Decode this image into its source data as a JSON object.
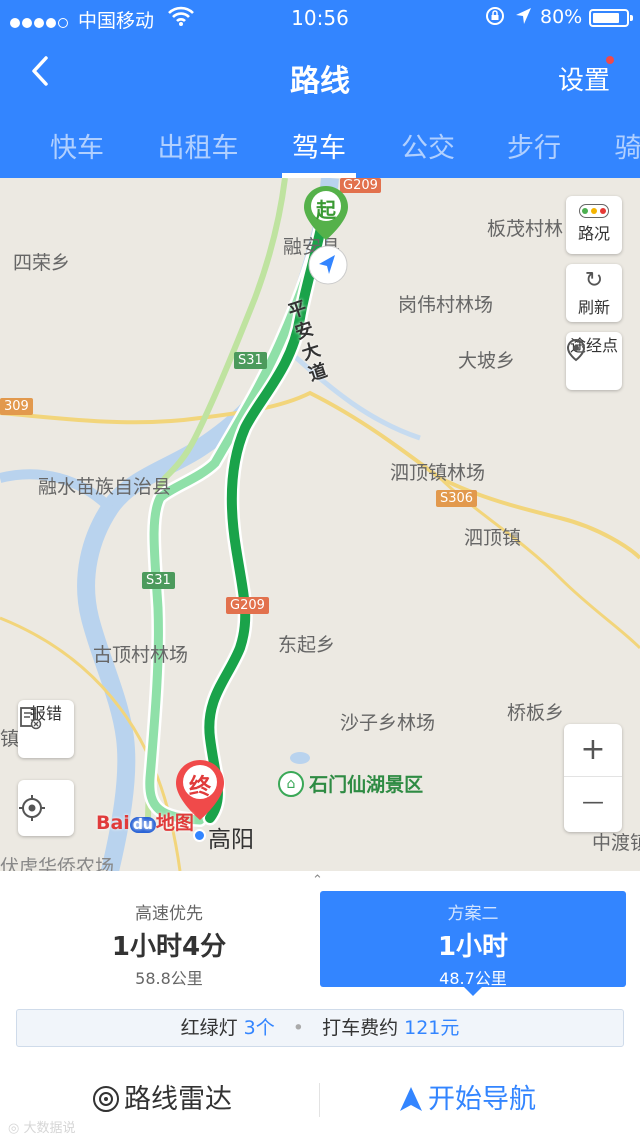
{
  "status_bar": {
    "carrier": "中国移动",
    "time": "10:56",
    "battery": "80%"
  },
  "header": {
    "title": "路线",
    "settings_label": "设置"
  },
  "tabs": [
    "快车",
    "出租车",
    "驾车",
    "公交",
    "步行",
    "骑"
  ],
  "active_tab": "驾车",
  "map": {
    "labels": {
      "rongan": "融安县",
      "bancun": "板茂村林",
      "sirong": "四荣乡",
      "gangwei": "岗伟村林场",
      "dapo": "大坡乡",
      "rongshui": "融水苗族自治县",
      "siding_forest": "泗顶镇林场",
      "siding": "泗顶镇",
      "dongqi": "东起乡",
      "guding": "古顶村林场",
      "shazi": "沙子乡林场",
      "qiaoban": "桥板乡",
      "shimen": "石门仙湖景区",
      "gaoyang": "高阳",
      "fuhu": "伏虎华侨农场",
      "zhongdu": "中渡镇",
      "zhen_left": "镇",
      "road_name": "平安大道"
    },
    "road_badges": {
      "g209_top": "G209",
      "s31_top": "S31",
      "s309": "309",
      "s306": "S306",
      "s31_mid": "S31",
      "g209_mid": "G209"
    },
    "markers": {
      "start": "起",
      "end": "终"
    },
    "buttons": {
      "traffic": "路况",
      "refresh": "刷新",
      "waypoint": "途经点",
      "report": "报错",
      "zoom_in": "+",
      "zoom_out": "—"
    },
    "logo": {
      "bai": "Bai",
      "du": "du",
      "ditu": "地图"
    }
  },
  "plans": [
    {
      "name": "高速优先",
      "time": "1小时4分",
      "distance": "58.8公里",
      "selected": false
    },
    {
      "name": "方案二",
      "time": "1小时",
      "distance": "48.7公里",
      "selected": true
    }
  ],
  "route_info": {
    "traffic_lights_label": "红绿灯",
    "traffic_lights_count": "3个",
    "separator": "•",
    "taxi_fare_label": "打车费约",
    "taxi_fare_value": "121元"
  },
  "actions": {
    "radar": "路线雷达",
    "start_nav": "开始导航"
  },
  "watermark": "大数据说",
  "colors": {
    "brand": "#3385ff",
    "route_primary": "#1aa34a",
    "route_alt": "#8fe0a8",
    "end_marker": "#f04a4a"
  }
}
